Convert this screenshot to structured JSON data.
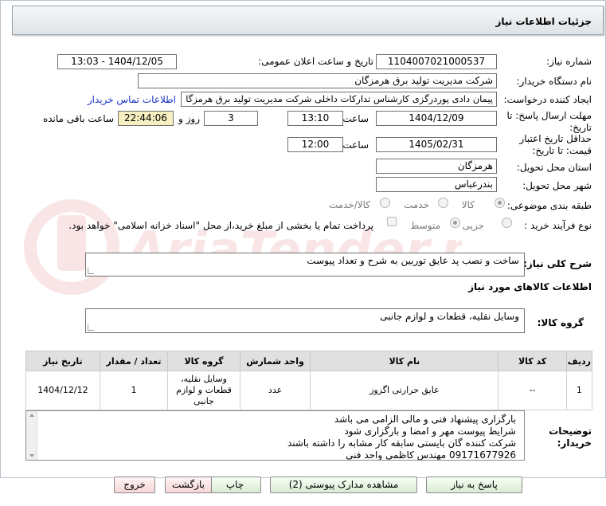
{
  "header": {
    "title": "جزئیات اطلاعات نیاز"
  },
  "watermark": {
    "text": "AriaTender.net"
  },
  "form": {
    "need_number": {
      "label": "شماره نیاز:",
      "value": "1104007021000537"
    },
    "announce_datetime": {
      "label": "تاریخ و ساعت اعلان عمومی:",
      "value": "1404/12/05 - 13:03"
    },
    "buyer_org": {
      "label": "نام دستگاه خریدار:",
      "value": "شرکت مدیریت تولید برق هرمزگان"
    },
    "requester": {
      "label": "ایجاد کننده درخواست:",
      "value": "پیمان دادی پوردرگزی کارشناس تدارکات داخلی شرکت مدیریت تولید برق هرمزگا",
      "contact_link": "اطلاعات تماس خریدار"
    },
    "deadline": {
      "label": "مهلت ارسال پاسخ: تا تاریخ:",
      "date": "1404/12/09",
      "time_label": "ساعت",
      "time": "13:10",
      "days": "3",
      "days_label": "روز و",
      "remaining": "22:44:06",
      "remaining_label": "ساعت باقی مانده"
    },
    "validity": {
      "label": "حداقل تاریخ اعتبار قیمت: تا تاریخ:",
      "date": "1405/02/31",
      "time_label": "ساعت",
      "time": "12:00"
    },
    "province": {
      "label": "استان محل تحویل:",
      "value": "هرمزگان"
    },
    "city": {
      "label": "شهر محل تحویل:",
      "value": "بندرعباس"
    },
    "category": {
      "label": "طبقه بندی موضوعی:",
      "options": [
        "کالا",
        "خدمت",
        "کالا/خدمت"
      ],
      "selected": "کالا"
    },
    "process": {
      "label": "نوع فرآیند خرید :",
      "options": [
        "جزیی",
        "متوسط"
      ],
      "selected": "جزیی",
      "payment_note": "پرداخت تمام یا بخشی از مبلغ خرید،از محل \"اسناد خزانه اسلامی\" خواهد بود."
    }
  },
  "need_description": {
    "label": "شرح کلی نیاز:",
    "value": "ساخت و نصب پد عایق توربین به شرح و تعداد پیوست"
  },
  "goods_section": {
    "title": "اطلاعات کالاهای مورد نیاز"
  },
  "goods_group": {
    "label": "گروه کالا:",
    "value": "وسایل نقلیه، قطعات و لوازم جانبی"
  },
  "items_table": {
    "headers": [
      "ردیف",
      "کد کالا",
      "نام کالا",
      "واحد شمارش",
      "گروه کالا",
      "تعداد / مقدار",
      "تاریخ نیاز"
    ],
    "rows": [
      [
        "1",
        "--",
        "عایق حرارتی اگزوز",
        "عدد",
        "وسایل نقلیه، قطعات و لوازم جانبی",
        "1",
        "1404/12/12"
      ]
    ]
  },
  "buyer_notes": {
    "label": "توضیحات خریدار:",
    "lines": [
      "بارگزاری پیشنهاد فنی و مالی الزامی می باشد",
      "شرایط پیوست مهر و امضا و بارگزاری شود",
      "شرکت کننده گان بایستی سابقه کار مشابه را داشته باشند",
      "09171677926 مهندس کاظمی واحد فنی"
    ]
  },
  "buttons": {
    "reply": "پاسخ به نیاز",
    "view_docs": "مشاهده مدارک پیوستی (2)",
    "print": "چاپ",
    "back": "بازگشت",
    "exit": "خروج"
  }
}
